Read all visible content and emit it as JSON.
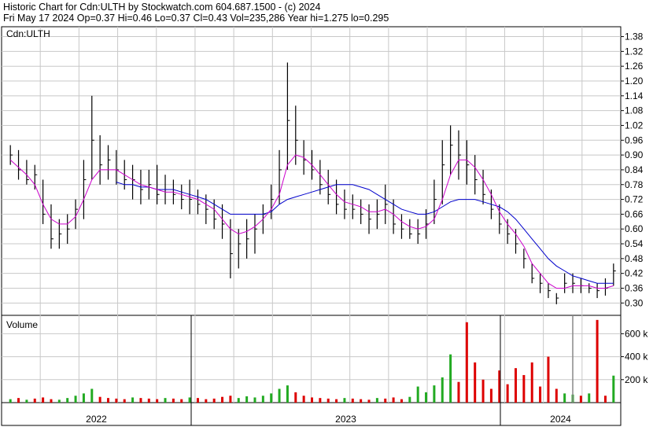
{
  "header": {
    "line1": "Historic Chart for Cdn:ULTH by Stockwatch.com 604.687.1500 - (c) 2024",
    "line2": "Fri May 17 2024  Op=0.37  Hi=0.46  Lo=0.37  Cl=0.43  Vol=235,286  Year hi=1.275  lo=0.295"
  },
  "chart_data": {
    "type": "line",
    "price_panel": {
      "symbol_label": "Cdn:ULTH",
      "ylim": [
        0.25,
        1.42
      ],
      "yticks": [
        "1.38",
        "1.32",
        "1.26",
        "1.20",
        "1.14",
        "1.08",
        "1.02",
        "0.96",
        "0.90",
        "0.84",
        "0.78",
        "0.72",
        "0.66",
        "0.60",
        "0.54",
        "0.48",
        "0.42",
        "0.36",
        "0.30"
      ],
      "grid": true,
      "price_bars": [
        [
          0.94,
          0.86,
          0.9
        ],
        [
          0.92,
          0.8,
          0.84
        ],
        [
          0.88,
          0.78,
          0.8
        ],
        [
          0.86,
          0.76,
          0.82
        ],
        [
          0.8,
          0.62,
          0.66
        ],
        [
          0.7,
          0.52,
          0.56
        ],
        [
          0.64,
          0.52,
          0.58
        ],
        [
          0.66,
          0.54,
          0.6
        ],
        [
          0.72,
          0.6,
          0.68
        ],
        [
          0.88,
          0.64,
          0.8
        ],
        [
          1.14,
          0.8,
          0.96
        ],
        [
          0.98,
          0.78,
          0.86
        ],
        [
          0.94,
          0.8,
          0.88
        ],
        [
          0.92,
          0.78,
          0.84
        ],
        [
          0.88,
          0.76,
          0.8
        ],
        [
          0.86,
          0.72,
          0.8
        ],
        [
          0.84,
          0.7,
          0.76
        ],
        [
          0.84,
          0.72,
          0.78
        ],
        [
          0.86,
          0.7,
          0.74
        ],
        [
          0.82,
          0.7,
          0.76
        ],
        [
          0.8,
          0.7,
          0.74
        ],
        [
          0.78,
          0.68,
          0.72
        ],
        [
          0.8,
          0.66,
          0.72
        ],
        [
          0.76,
          0.66,
          0.7
        ],
        [
          0.74,
          0.62,
          0.68
        ],
        [
          0.72,
          0.6,
          0.64
        ],
        [
          0.7,
          0.56,
          0.62
        ],
        [
          0.64,
          0.4,
          0.5
        ],
        [
          0.6,
          0.44,
          0.54
        ],
        [
          0.64,
          0.48,
          0.56
        ],
        [
          0.66,
          0.5,
          0.6
        ],
        [
          0.7,
          0.58,
          0.66
        ],
        [
          0.78,
          0.64,
          0.72
        ],
        [
          0.92,
          0.7,
          0.84
        ],
        [
          1.275,
          0.84,
          1.04
        ],
        [
          1.1,
          0.86,
          0.96
        ],
        [
          0.96,
          0.82,
          0.88
        ],
        [
          0.92,
          0.8,
          0.84
        ],
        [
          0.88,
          0.74,
          0.78
        ],
        [
          0.84,
          0.7,
          0.74
        ],
        [
          0.8,
          0.66,
          0.7
        ],
        [
          0.76,
          0.64,
          0.68
        ],
        [
          0.74,
          0.64,
          0.68
        ],
        [
          0.72,
          0.62,
          0.66
        ],
        [
          0.7,
          0.58,
          0.64
        ],
        [
          0.72,
          0.6,
          0.66
        ],
        [
          0.78,
          0.62,
          0.7
        ],
        [
          0.72,
          0.58,
          0.62
        ],
        [
          0.66,
          0.56,
          0.6
        ],
        [
          0.64,
          0.56,
          0.58
        ],
        [
          0.64,
          0.54,
          0.58
        ],
        [
          0.68,
          0.56,
          0.62
        ],
        [
          0.8,
          0.62,
          0.72
        ],
        [
          0.96,
          0.7,
          0.86
        ],
        [
          1.02,
          0.82,
          0.94
        ],
        [
          1.0,
          0.8,
          0.9
        ],
        [
          0.96,
          0.78,
          0.86
        ],
        [
          0.9,
          0.74,
          0.8
        ],
        [
          0.84,
          0.7,
          0.74
        ],
        [
          0.76,
          0.64,
          0.68
        ],
        [
          0.7,
          0.58,
          0.62
        ],
        [
          0.64,
          0.54,
          0.58
        ],
        [
          0.6,
          0.5,
          0.54
        ],
        [
          0.52,
          0.44,
          0.48
        ],
        [
          0.46,
          0.38,
          0.4
        ],
        [
          0.42,
          0.34,
          0.38
        ],
        [
          0.38,
          0.32,
          0.35
        ],
        [
          0.34,
          0.295,
          0.32
        ],
        [
          0.42,
          0.34,
          0.38
        ],
        [
          0.42,
          0.34,
          0.38
        ],
        [
          0.4,
          0.34,
          0.37
        ],
        [
          0.38,
          0.34,
          0.36
        ],
        [
          0.38,
          0.32,
          0.35
        ],
        [
          0.4,
          0.33,
          0.36
        ],
        [
          0.46,
          0.37,
          0.43
        ]
      ],
      "ma_short": [
        0.88,
        0.85,
        0.82,
        0.78,
        0.7,
        0.64,
        0.62,
        0.62,
        0.65,
        0.72,
        0.8,
        0.84,
        0.84,
        0.84,
        0.82,
        0.8,
        0.78,
        0.77,
        0.76,
        0.75,
        0.75,
        0.74,
        0.73,
        0.72,
        0.7,
        0.68,
        0.64,
        0.6,
        0.58,
        0.59,
        0.61,
        0.64,
        0.68,
        0.74,
        0.86,
        0.9,
        0.89,
        0.86,
        0.82,
        0.78,
        0.74,
        0.71,
        0.7,
        0.69,
        0.67,
        0.67,
        0.68,
        0.66,
        0.63,
        0.61,
        0.6,
        0.61,
        0.64,
        0.72,
        0.82,
        0.88,
        0.88,
        0.85,
        0.8,
        0.74,
        0.67,
        0.62,
        0.58,
        0.53,
        0.46,
        0.42,
        0.38,
        0.36,
        0.36,
        0.37,
        0.37,
        0.37,
        0.36,
        0.36,
        0.37
      ],
      "ma_long": [
        null,
        null,
        null,
        null,
        null,
        null,
        null,
        null,
        null,
        null,
        null,
        null,
        null,
        0.79,
        0.78,
        0.78,
        0.77,
        0.77,
        0.76,
        0.76,
        0.76,
        0.75,
        0.74,
        0.73,
        0.72,
        0.7,
        0.68,
        0.66,
        0.66,
        0.66,
        0.66,
        0.66,
        0.67,
        0.7,
        0.72,
        0.73,
        0.74,
        0.75,
        0.76,
        0.77,
        0.78,
        0.78,
        0.78,
        0.77,
        0.76,
        0.74,
        0.72,
        0.7,
        0.68,
        0.67,
        0.66,
        0.66,
        0.67,
        0.69,
        0.71,
        0.72,
        0.72,
        0.72,
        0.71,
        0.7,
        0.69,
        0.67,
        0.64,
        0.6,
        0.56,
        0.52,
        0.48,
        0.45,
        0.43,
        0.41,
        0.4,
        0.39,
        0.38,
        0.38,
        0.38
      ]
    },
    "volume_panel": {
      "label": "Volume",
      "ylim": [
        0,
        760
      ],
      "yticks": [
        "600 k",
        "400 k",
        "200 k"
      ],
      "values_k": [
        30,
        40,
        25,
        35,
        45,
        30,
        25,
        40,
        60,
        80,
        120,
        50,
        40,
        35,
        30,
        45,
        40,
        35,
        30,
        40,
        35,
        30,
        45,
        40,
        30,
        35,
        50,
        60,
        40,
        55,
        45,
        60,
        80,
        120,
        150,
        90,
        60,
        45,
        40,
        35,
        30,
        40,
        35,
        30,
        25,
        40,
        35,
        45,
        30,
        50,
        140,
        90,
        150,
        220,
        420,
        180,
        700,
        350,
        200,
        120,
        280,
        160,
        300,
        240,
        350,
        140,
        400,
        120,
        80,
        70,
        60,
        80,
        720,
        60,
        235
      ],
      "up": [
        true,
        false,
        true,
        false,
        false,
        false,
        true,
        true,
        true,
        true,
        true,
        false,
        false,
        false,
        false,
        true,
        false,
        false,
        false,
        true,
        false,
        false,
        true,
        false,
        false,
        false,
        false,
        false,
        true,
        true,
        true,
        true,
        true,
        true,
        true,
        false,
        false,
        false,
        false,
        false,
        false,
        true,
        false,
        false,
        false,
        true,
        false,
        false,
        false,
        true,
        true,
        true,
        true,
        true,
        true,
        false,
        false,
        false,
        false,
        false,
        false,
        false,
        false,
        false,
        false,
        false,
        false,
        false,
        true,
        true,
        false,
        true,
        false,
        false,
        true
      ]
    },
    "x_axis": {
      "labels": [
        "2022",
        "2023",
        "2024"
      ]
    }
  },
  "colors": {
    "up": "#22aa22",
    "down": "#dd0000",
    "price": "#000000",
    "ma_short": "#cc00cc",
    "ma_long": "#0000cc",
    "grid": "#c8c8c8",
    "marker": "#888888"
  }
}
